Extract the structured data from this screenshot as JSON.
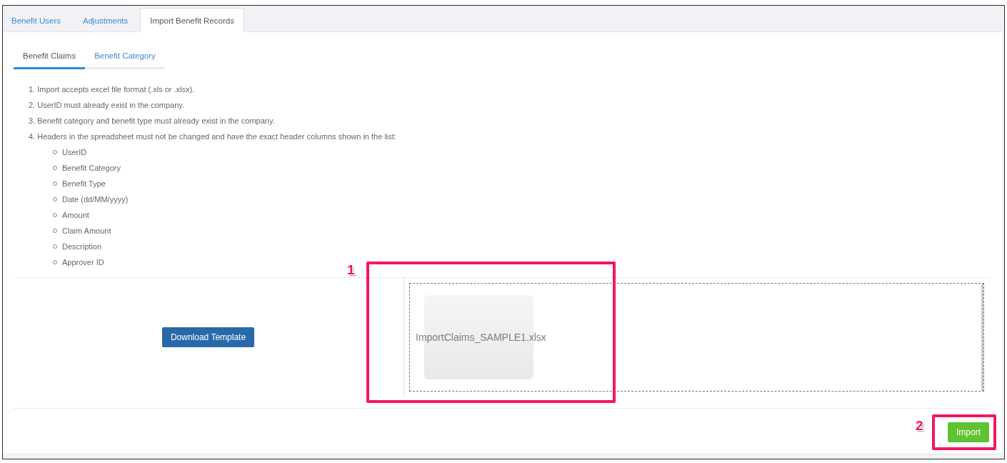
{
  "tabs": [
    {
      "label": "Benefit Users",
      "selected": false
    },
    {
      "label": "Adjustments",
      "selected": false
    },
    {
      "label": "Import Benefit Records",
      "selected": true
    }
  ],
  "subtabs": [
    {
      "label": "Benefit Claims",
      "selected": true
    },
    {
      "label": "Benefit Category",
      "selected": false
    }
  ],
  "instructions": [
    {
      "text": "1. Import accepts excel file format (.xls or .xlsx)."
    },
    {
      "text": "2. UserID must already exist in the company."
    },
    {
      "text": "3. Benefit category and benefit type must already exist in the company."
    },
    {
      "text": "4. Headers in the spreadsheet must not be changed and have the exact header columns shown in the list:",
      "children": [
        {
          "text": "UserID"
        },
        {
          "text": "Benefit Category"
        },
        {
          "text": "Benefit Type"
        },
        {
          "text": "Date (dd/MM/yyyy)"
        },
        {
          "text": "Amount"
        },
        {
          "text": "Claim Amount"
        },
        {
          "text": "Description"
        },
        {
          "text": "Approver ID"
        }
      ]
    }
  ],
  "download_button": "Download Template",
  "dropzone": {
    "file_name": "ImportClaims_SAMPLE1.xlsx"
  },
  "import_button": "Import",
  "annotations": [
    {
      "label": "1"
    },
    {
      "label": "2"
    }
  ]
}
